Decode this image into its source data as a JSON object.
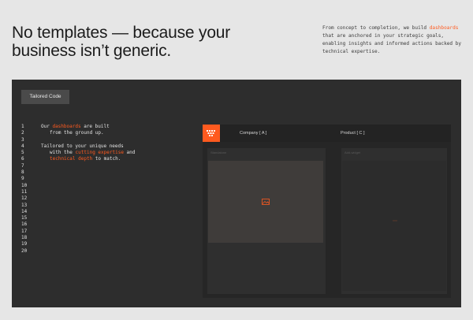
{
  "headline": "No templates — because your business isn’t generic.",
  "intro": {
    "before": "From concept to completion, we build ",
    "highlight": "dashboards",
    "after": " that are anchored in your strategic goals, enabling insights and informed actions backed by technical expertise."
  },
  "panel": {
    "tag_label": "Tailored Code",
    "line_numbers": [
      "1",
      "2",
      "3",
      "4",
      "5",
      "6",
      "7",
      "8",
      "9",
      "10",
      "11",
      "12",
      "13",
      "14",
      "15",
      "16",
      "17",
      "18",
      "19",
      "20"
    ],
    "code": {
      "l1_a": "Our ",
      "l1_hl": "dashboards",
      "l1_b": " are built",
      "l2": "from the ground up.",
      "l4": "Tailored to your unique needs",
      "l5_a": "with the ",
      "l5_hl": "cutting expertise",
      "l5_b": " and",
      "l6_hl": "technical depth",
      "l6_b": " to match."
    },
    "mock": {
      "tab_a": "Company [ A ]",
      "tab_b": "Product [ C ]",
      "card_a_label": "Standalone",
      "card_b_label": "Add-widget"
    }
  },
  "colors": {
    "accent": "#ff5a1f",
    "panel": "#2d2d2d",
    "background": "#e6e6e6"
  }
}
